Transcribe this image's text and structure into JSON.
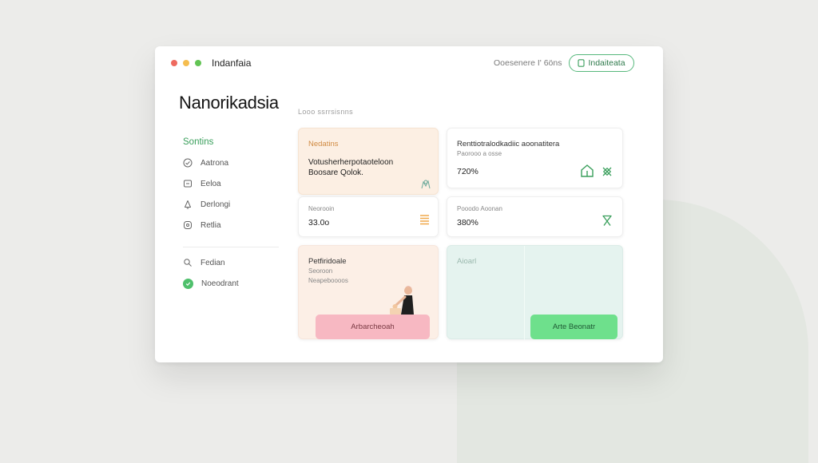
{
  "window": {
    "title": "Indanfaia",
    "status_text": "Ooesenere I' 6öns",
    "top_button_label": "Indaiteata",
    "dot_colors": [
      "#ee6a5f",
      "#f5bd4f",
      "#62c454"
    ]
  },
  "page": {
    "title": "Nanorikadsia",
    "breadcrumb": "Looo ssrrsisnns"
  },
  "sidebar": {
    "header": "Sontins",
    "items": [
      {
        "label": "Aatrona",
        "icon": "check-circle-icon"
      },
      {
        "label": "Eeloa",
        "icon": "square-icon"
      },
      {
        "label": "Derlongi",
        "icon": "bell-icon"
      },
      {
        "label": "Retlia",
        "icon": "badge-icon"
      }
    ],
    "secondary_items": [
      {
        "label": "Fedian",
        "icon": "pin-icon"
      },
      {
        "label": "Noeodrant",
        "icon": "green-badge-icon"
      }
    ]
  },
  "cards": {
    "card1": {
      "title": "Nedatins",
      "body_line1": "Votusherherpotaoteloon",
      "body_line2": "Boosare Qolok.",
      "icon": "tree-icon"
    },
    "card2": {
      "title": "Renttiotralodkadiic aoonatitera",
      "subtitle": "Paorooo a osse",
      "value": "720%",
      "icons": [
        "house-icon",
        "pattern-icon"
      ]
    },
    "card3": {
      "subtitle": "Neorooin",
      "value": "33.0o",
      "icon": "bars-icon"
    },
    "card4": {
      "subtitle": "Pooodo Aoonan",
      "value": "380%",
      "icon": "hourglass-icon"
    },
    "card5": {
      "title": "Petfiridoale",
      "subtitle1": "Seoroon",
      "subtitle2": "Neapeboooos",
      "button_label": "Arbarcheoah",
      "button_color": "#f7b8c2"
    },
    "card6": {
      "title": "Aioarl",
      "button_label": "Arte Beonatr",
      "button_color": "#6ee08c"
    }
  },
  "colors": {
    "accent_green": "#3a9f5c",
    "card1_bg": "#fcefe3",
    "card5_bg": "#fcefe6",
    "card6_bg": "#e5f3ef",
    "bars_orange": "#f0a94a"
  }
}
